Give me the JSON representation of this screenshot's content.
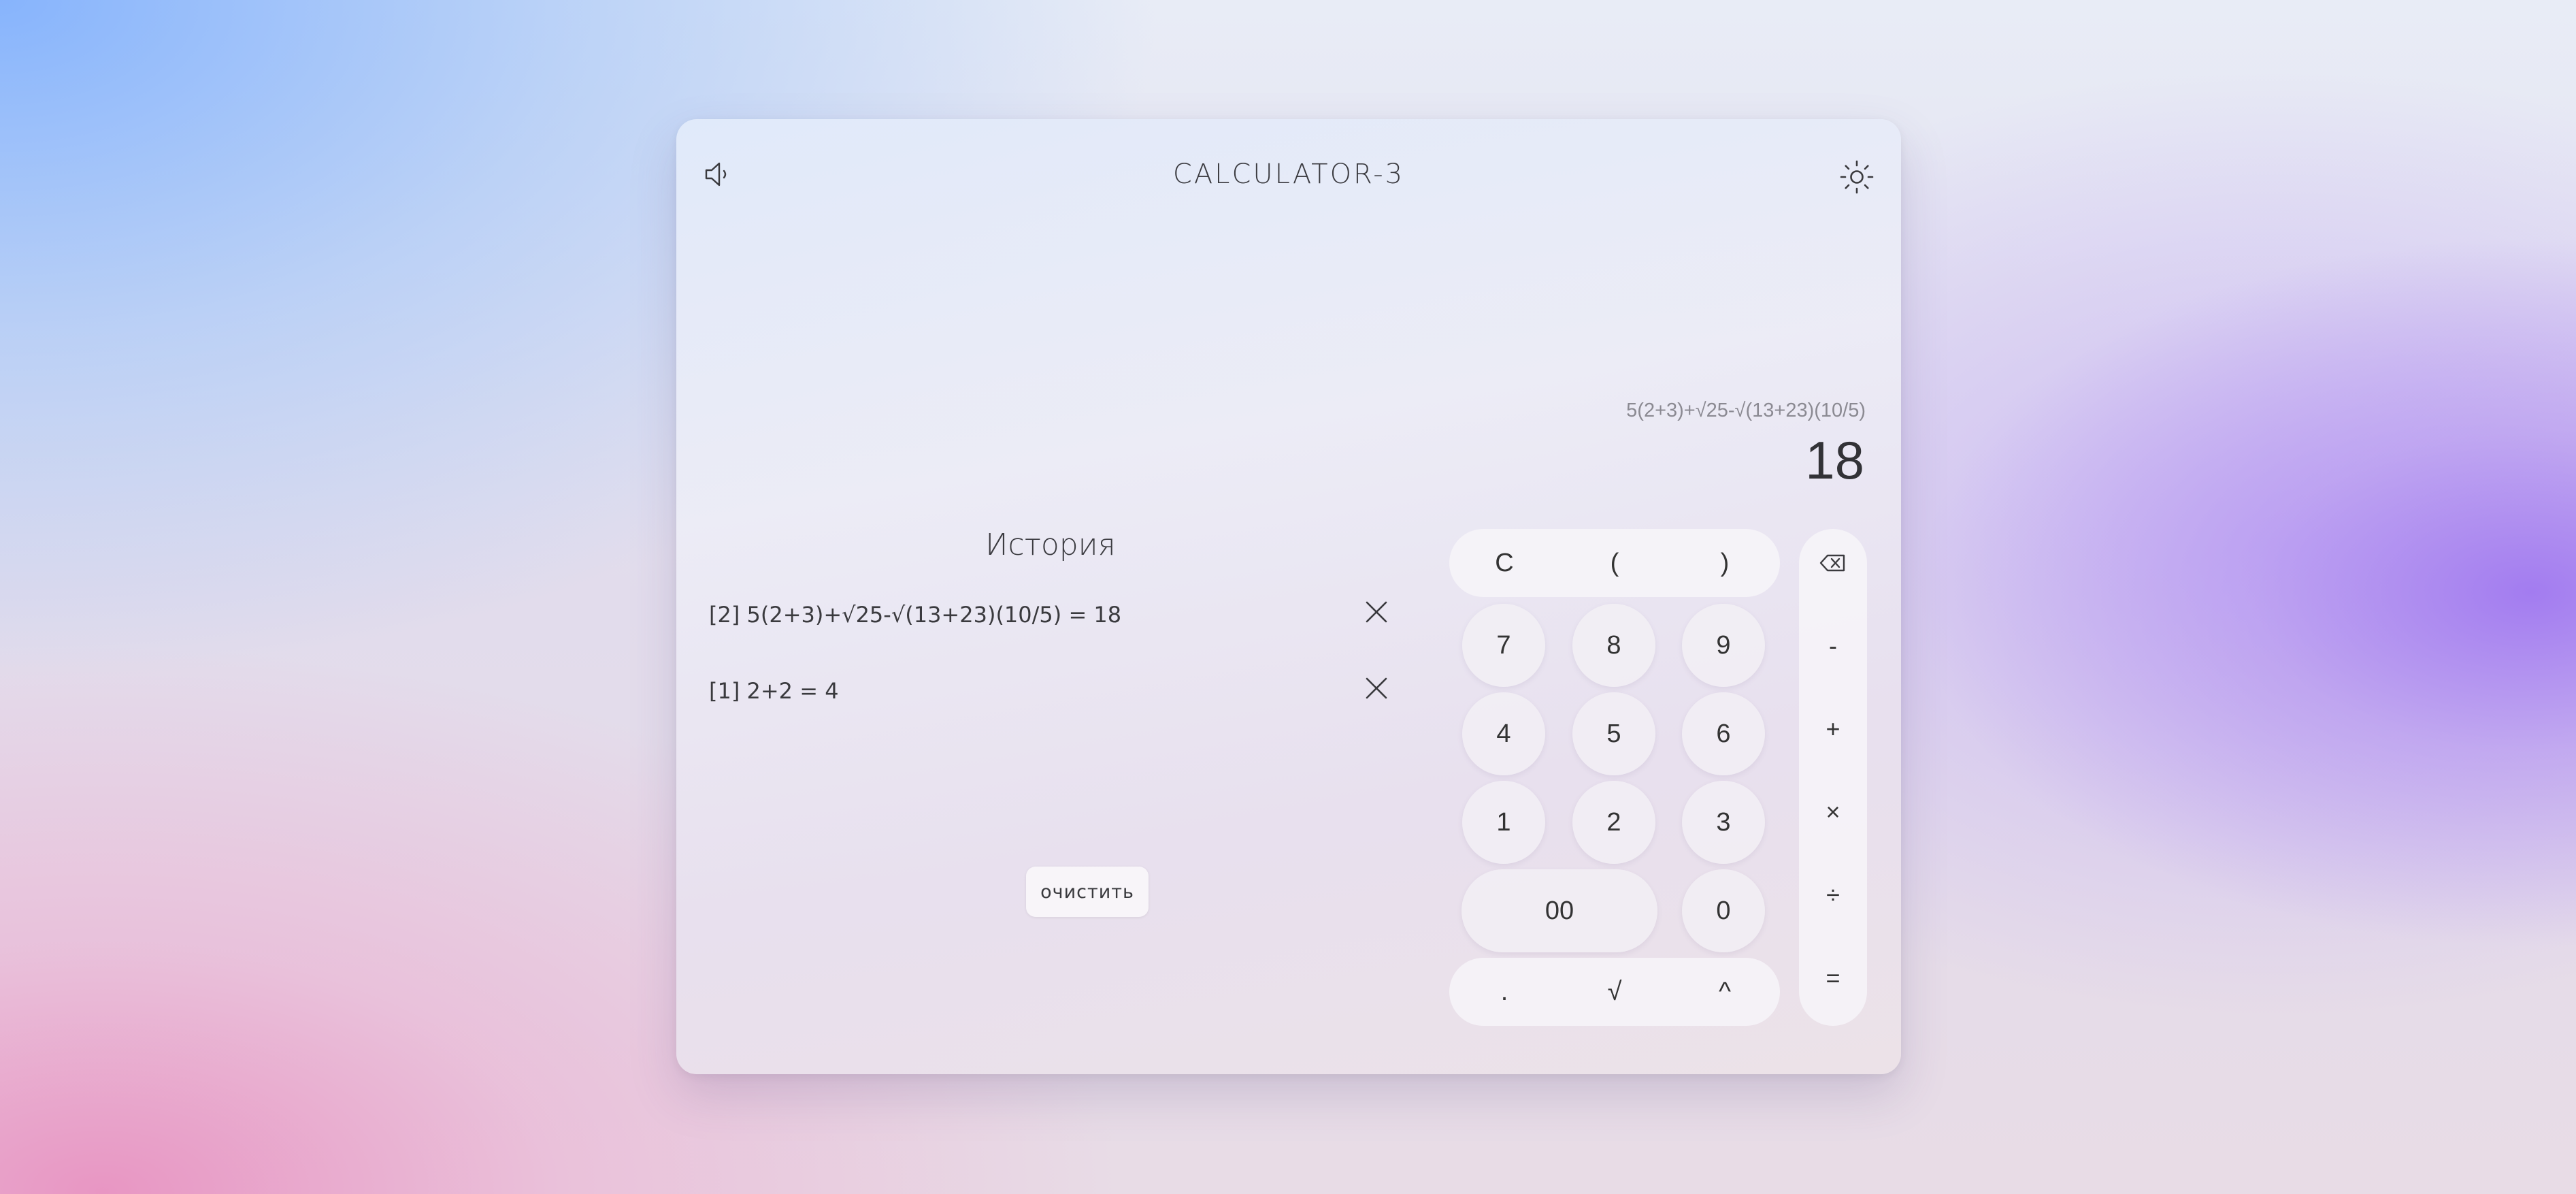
{
  "app": {
    "title": "CALCULATOR-3"
  },
  "icons": {
    "sound": "speaker-icon",
    "theme": "sun-icon",
    "delete": "close-icon",
    "backspace": "backspace-icon"
  },
  "display": {
    "expression": "5(2+3)+√25-√(13+23)(10/5)",
    "result": "18"
  },
  "history": {
    "title": "История",
    "items": [
      {
        "text": "[2] 5(2+3)+√25-√(13+23)(10/5) = 18"
      },
      {
        "text": "[1] 2+2 = 4"
      }
    ],
    "clear_label": "очистить"
  },
  "keypad": {
    "top_row": [
      "C",
      "(",
      ")"
    ],
    "digits": [
      "7",
      "8",
      "9",
      "4",
      "5",
      "6",
      "1",
      "2",
      "3"
    ],
    "double_zero": "00",
    "zero": "0",
    "bottom_row": [
      ".",
      "√",
      "^"
    ],
    "operators": [
      "-",
      "+",
      "×",
      "÷",
      "="
    ]
  },
  "colors": {
    "text": "#3a3a3e",
    "expression": "#8b8a92",
    "panel": "#eceaf4"
  }
}
